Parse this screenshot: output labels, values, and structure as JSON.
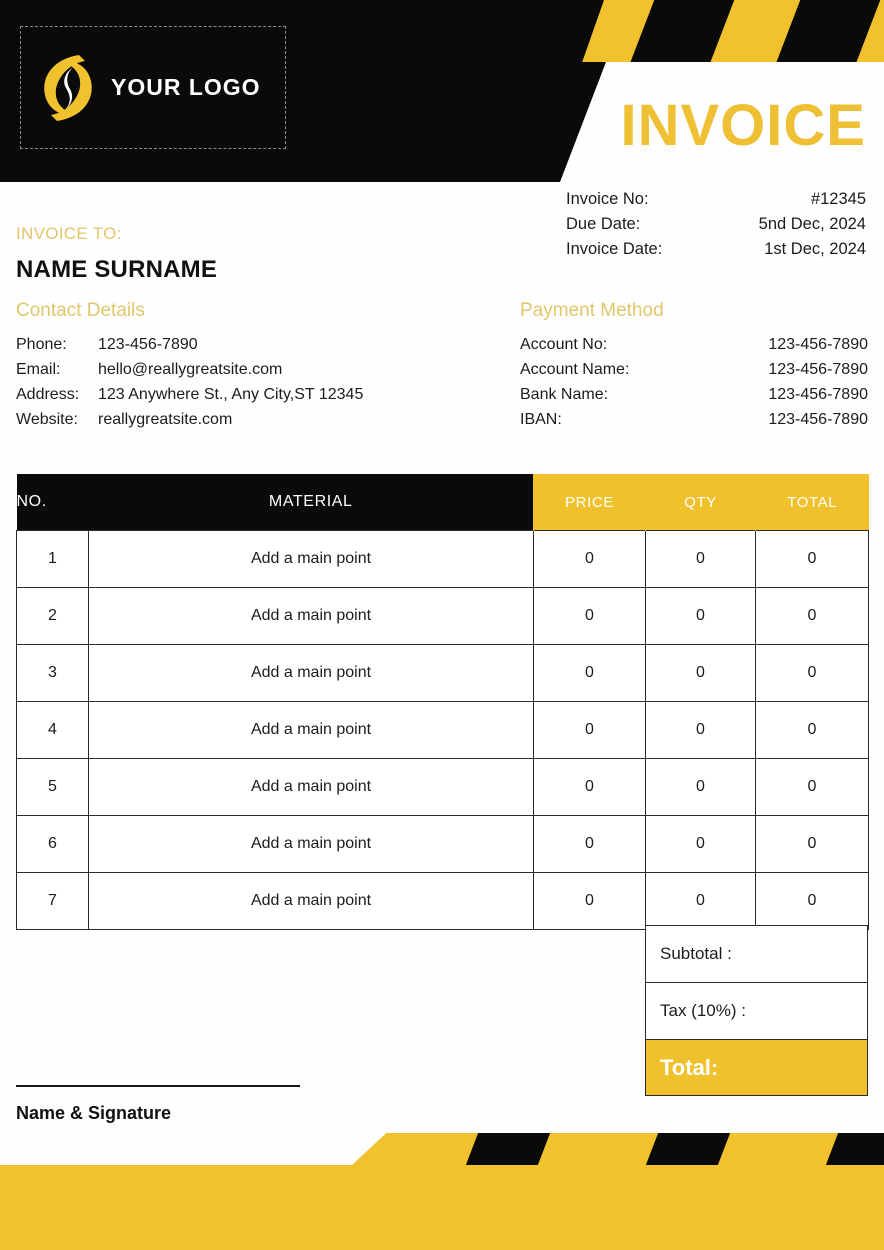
{
  "document": {
    "title": "INVOICE",
    "type": "invoice-template"
  },
  "colors": {
    "yellow": "#F1C22E",
    "gold_title": "#EFBF34",
    "gold_label": "#E0C76B",
    "black": "#0A0A0A",
    "white": "#FFFFFF",
    "text": "#1C1C1C"
  },
  "header": {
    "logo_text": "YOUR LOGO",
    "logo_icon": "swirl-s-logo-icon"
  },
  "meta": {
    "rows": [
      {
        "label": "Invoice No:",
        "value": "#12345"
      },
      {
        "label": "Due Date:",
        "value": "5nd Dec, 2024"
      },
      {
        "label": "Invoice Date:",
        "value": "1st Dec, 2024"
      }
    ]
  },
  "bill_to": {
    "heading": "INVOICE TO:",
    "client_name": "NAME SURNAME",
    "contact_heading": "Contact Details",
    "rows": [
      {
        "label": "Phone:",
        "value": "123-456-7890"
      },
      {
        "label": "Email:",
        "value": "hello@reallygreatsite.com"
      },
      {
        "label": "Address:",
        "value": "123 Anywhere St., Any City,ST 12345"
      },
      {
        "label": "Website:",
        "value": "reallygreatsite.com"
      }
    ]
  },
  "payment": {
    "heading": "Payment Method",
    "rows": [
      {
        "label": "Account No:",
        "value": "123-456-7890"
      },
      {
        "label": "Account Name:",
        "value": "123-456-7890"
      },
      {
        "label": "Bank Name:",
        "value": "123-456-7890"
      },
      {
        "label": "IBAN:",
        "value": "123-456-7890"
      }
    ]
  },
  "table": {
    "columns": [
      "NO.",
      "MATERIAL",
      "PRICE",
      "QTY",
      "TOTAL"
    ],
    "rows": [
      {
        "no": "1",
        "material": "Add a main point",
        "price": "0",
        "qty": "0",
        "total": "0"
      },
      {
        "no": "2",
        "material": "Add a main point",
        "price": "0",
        "qty": "0",
        "total": "0"
      },
      {
        "no": "3",
        "material": "Add a main point",
        "price": "0",
        "qty": "0",
        "total": "0"
      },
      {
        "no": "4",
        "material": "Add a main point",
        "price": "0",
        "qty": "0",
        "total": "0"
      },
      {
        "no": "5",
        "material": "Add a main point",
        "price": "0",
        "qty": "0",
        "total": "0"
      },
      {
        "no": "6",
        "material": "Add a main point",
        "price": "0",
        "qty": "0",
        "total": "0"
      },
      {
        "no": "7",
        "material": "Add a main point",
        "price": "0",
        "qty": "0",
        "total": "0"
      }
    ]
  },
  "totals": {
    "subtotal_label": "Subtotal :",
    "subtotal_value": "",
    "tax_label": "Tax (10%) :",
    "tax_value": "",
    "grand_label": "Total:",
    "grand_value": ""
  },
  "signature": {
    "label": "Name & Signature"
  }
}
